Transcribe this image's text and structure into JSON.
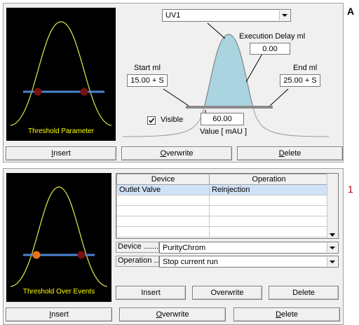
{
  "corner_label": "A",
  "marker_label": "1",
  "colors": {
    "curve": "#e8e84a",
    "line": "#4a86d0",
    "marker": "#7a1010",
    "marker_active": "#f07010",
    "peak_fill": "#a9d4e0",
    "marker_label": "#c00000"
  },
  "threshold_parameter": {
    "caption": "Threshold Parameter",
    "detector_combo": "UV1",
    "execution_delay_label": "Execution Delay ml",
    "execution_delay_value": "0.00",
    "start_label": "Start ml",
    "start_value": "15.00 + S",
    "end_label": "End ml",
    "end_value": "25.00 + S",
    "visible_label": "Visible",
    "visible_checked": true,
    "value_field": "60.00",
    "value_label": "Value [ mAU ]",
    "buttons": {
      "insert": "Insert",
      "overwrite": "Overwrite",
      "delete": "Delete"
    }
  },
  "threshold_events": {
    "caption": "Threshold Over Events",
    "table": {
      "columns": [
        "Device",
        "Operation"
      ],
      "rows": [
        [
          "Outlet Valve",
          "Reinjection"
        ],
        [
          "",
          ""
        ],
        [
          "",
          ""
        ],
        [
          "",
          ""
        ],
        [
          "",
          ""
        ]
      ]
    },
    "device_label": "Device ........",
    "device_value": "PurityChrom",
    "operation_label": "Operation ...",
    "operation_value": "Stop current run",
    "inner_buttons": {
      "insert": "Insert",
      "overwrite": "Overwrite",
      "delete": "Delete"
    },
    "buttons": {
      "insert": "Insert",
      "overwrite": "Overwrite",
      "delete": "Delete"
    }
  }
}
